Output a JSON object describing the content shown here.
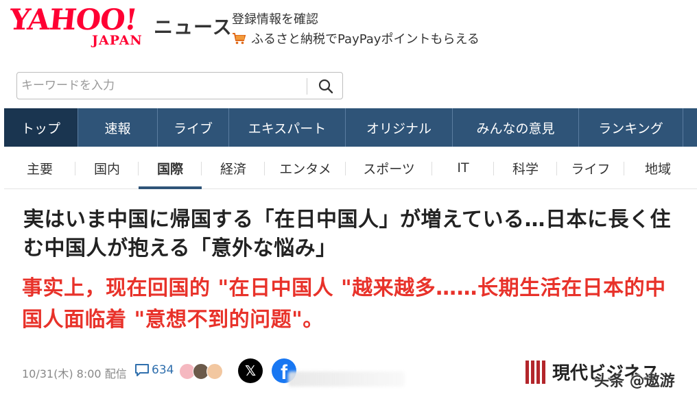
{
  "header": {
    "logo_text": "YAHOO!",
    "logo_subtext": "JAPAN",
    "section_title": "ニュース",
    "account_link": "登録情報を確認",
    "promo_link": "ふるさと納税でPayPayポイントもらえる"
  },
  "search": {
    "placeholder": "キーワードを入力",
    "button_icon": "search-icon"
  },
  "main_nav": {
    "items": [
      {
        "label": "トップ",
        "active": true
      },
      {
        "label": "速報",
        "active": false
      },
      {
        "label": "ライブ",
        "active": false
      },
      {
        "label": "エキスパート",
        "active": false
      },
      {
        "label": "オリジナル",
        "active": false
      },
      {
        "label": "みんなの意見",
        "active": false
      },
      {
        "label": "ランキング",
        "active": false
      }
    ]
  },
  "sub_nav": {
    "items": [
      {
        "label": "主要",
        "active": false
      },
      {
        "label": "国内",
        "active": false
      },
      {
        "label": "国際",
        "active": true
      },
      {
        "label": "経済",
        "active": false
      },
      {
        "label": "エンタメ",
        "active": false
      },
      {
        "label": "スポーツ",
        "active": false
      },
      {
        "label": "IT",
        "active": false
      },
      {
        "label": "科学",
        "active": false
      },
      {
        "label": "ライフ",
        "active": false
      },
      {
        "label": "地域",
        "active": false
      }
    ]
  },
  "article": {
    "title": "実はいま中国に帰国する「在日中国人」が増えている…日本に長く住む中国人が抱える「意外な悩み」",
    "caption": "事实上，现在回国的 \"在日中国人 \"越来越多……长期生活在日本的中国人面临着 \"意想不到的问题\"。",
    "date": "10/31(木) 8:00 配信",
    "comment_count": "634",
    "share_buttons": [
      "x-icon",
      "facebook-icon"
    ],
    "publisher": "現代ビジネス"
  },
  "watermark": "头条 @遨游",
  "colors": {
    "brand_red": "#ff0033",
    "nav_blue": "#2f5478",
    "caption_red": "#e8322a",
    "link_blue": "#2f6fad"
  }
}
